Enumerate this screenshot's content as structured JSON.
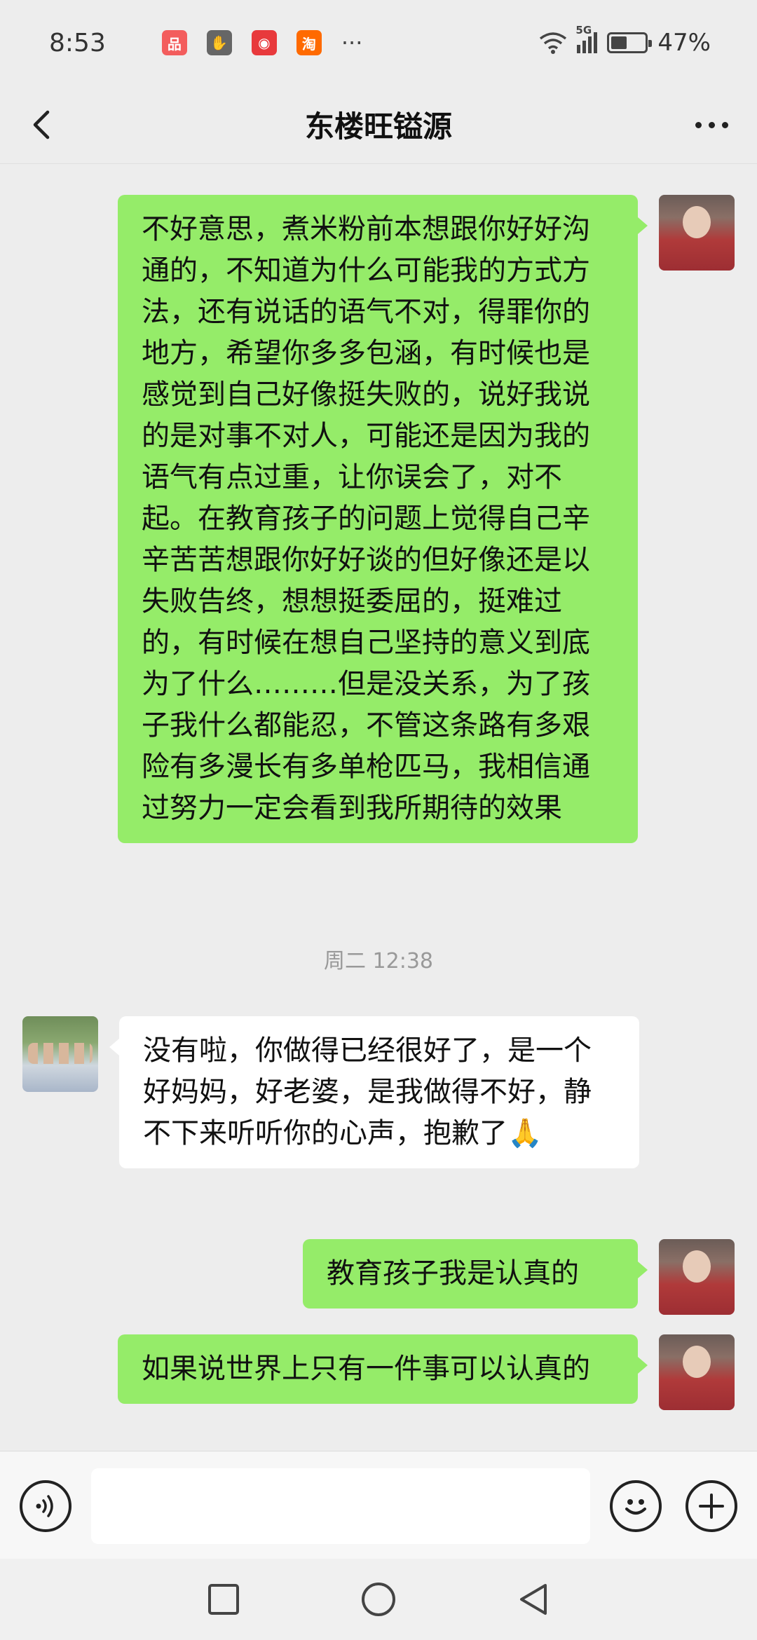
{
  "status_bar": {
    "time": "8:53",
    "app_icons": [
      {
        "name": "camera-app-icon",
        "glyph": "品",
        "color": "#f35d5d"
      },
      {
        "name": "hand-app-icon",
        "glyph": "✋",
        "color": "#666666"
      },
      {
        "name": "promo-app-icon",
        "glyph": "◉",
        "color": "#e8393c"
      },
      {
        "name": "taobao-app-icon",
        "glyph": "淘",
        "color": "#ff6a00"
      }
    ],
    "more": "···",
    "network": "5G",
    "battery_percent": "47%",
    "battery_level": 0.47
  },
  "header": {
    "title": "东楼旺镒源"
  },
  "messages": [
    {
      "from": "self",
      "text": "不好意思，煮米粉前本想跟你好好沟通的，不知道为什么可能我的方式方法，还有说话的语气不对，得罪你的地方，希望你多多包涵，有时候也是感觉到自己好像挺失败的，说好我说的是对事不对人，可能还是因为我的语气有点过重，让你误会了，对不起。在教育孩子的问题上觉得自己辛辛苦苦想跟你好好谈的但好像还是以失败告终，想想挺委屈的，挺难过的，有时候在想自己坚持的意义到底为了什么………但是没关系，为了孩子我什么都能忍，不管这条路有多艰险有多漫长有多单枪匹马，我相信通过努力一定会看到我所期待的效果"
    },
    {
      "from": "other",
      "text": "没有啦，你做得已经很好了，是一个好妈妈，好老婆，是我做得不好，静不下来听听你的心声，抱歉了🙏"
    },
    {
      "from": "self",
      "text": "教育孩子我是认真的"
    },
    {
      "from": "self",
      "text": "如果说世界上只有一件事可以认真的"
    }
  ],
  "timestamp": "周二 12:38",
  "input_bar": {
    "placeholder": "",
    "value": ""
  },
  "colors": {
    "self_bubble": "#95ec69",
    "other_bubble": "#ffffff",
    "background": "#ededed"
  }
}
